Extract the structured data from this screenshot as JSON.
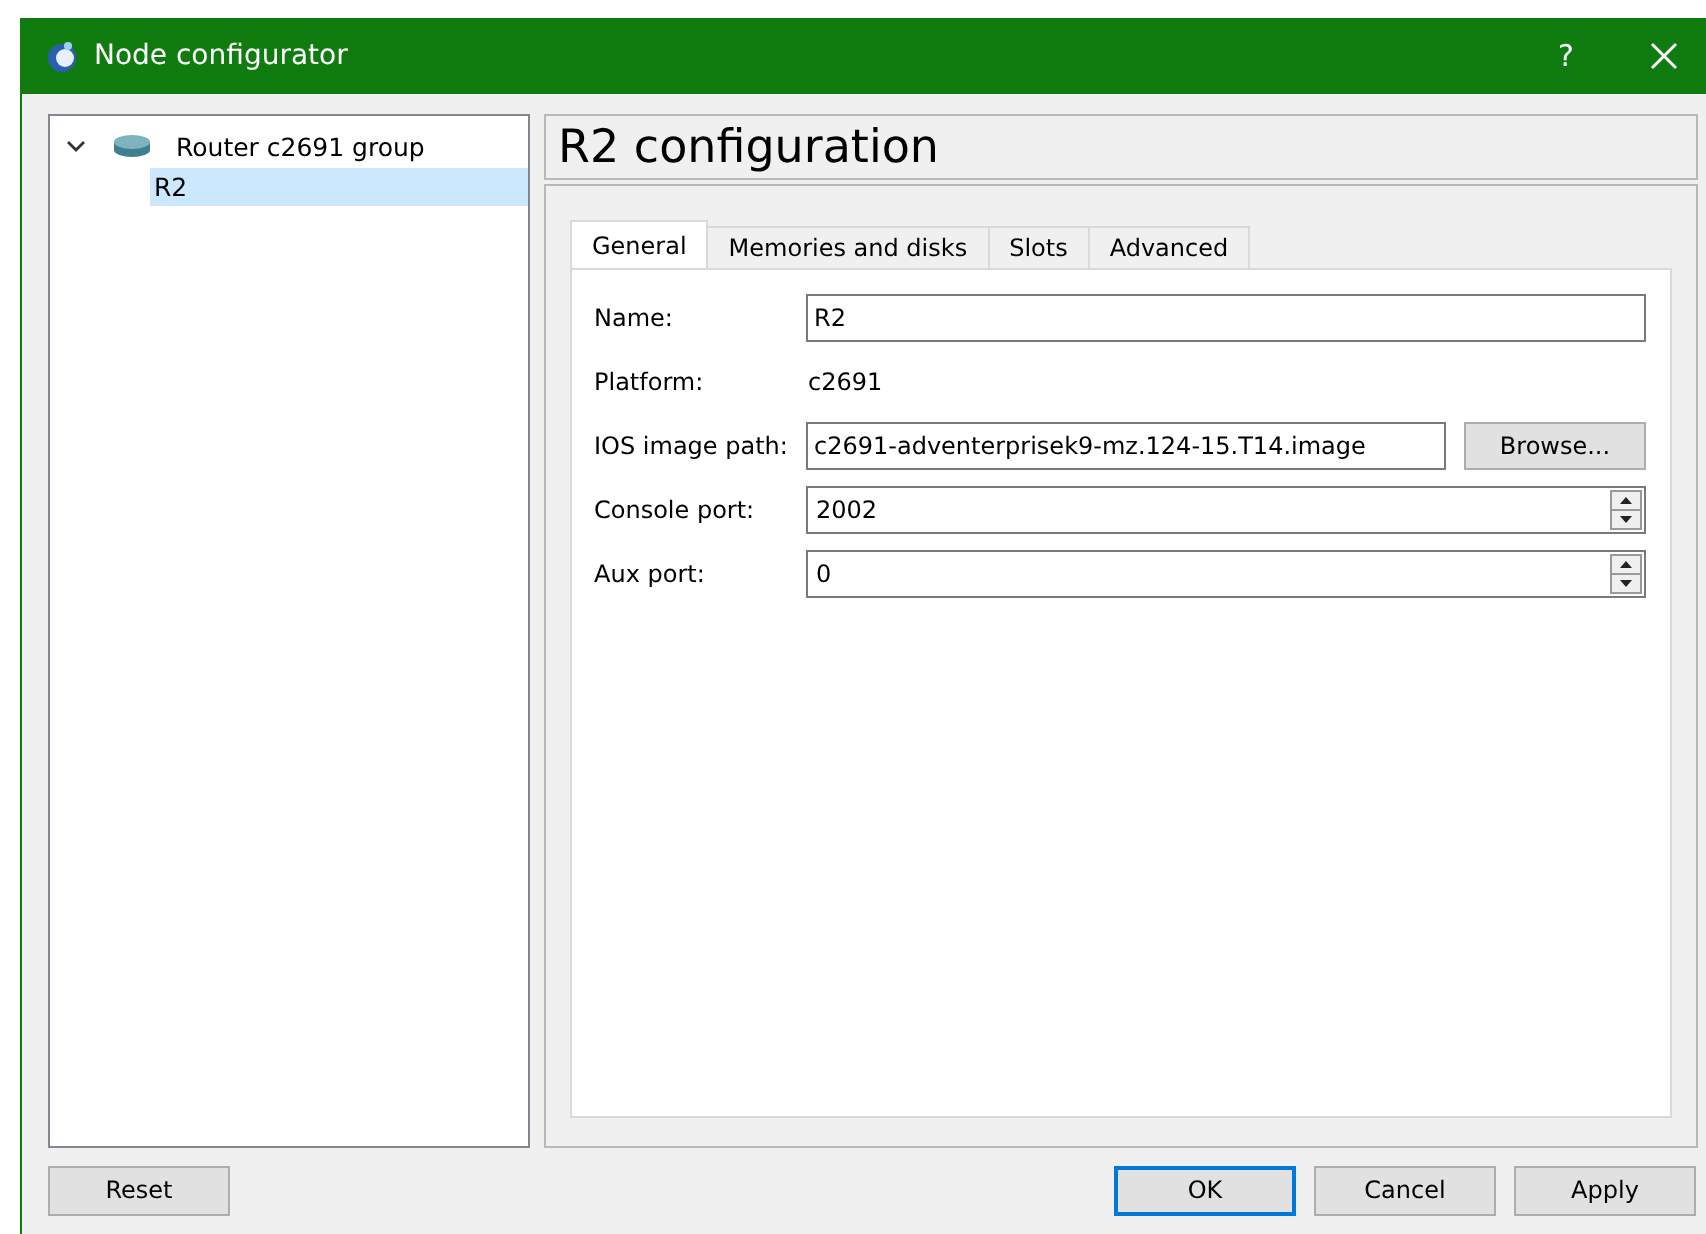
{
  "window": {
    "title": "Node configurator",
    "help": "?"
  },
  "tree": [
    {
      "label": "Router c2691 group",
      "expanded": true,
      "selected": false,
      "children": [
        {
          "label": "R2",
          "selected": true
        }
      ]
    }
  ],
  "header": "R2 configuration",
  "tabs": [
    {
      "label": "General",
      "selected": true
    },
    {
      "label": "Memories and disks",
      "selected": false
    },
    {
      "label": "Slots",
      "selected": false
    },
    {
      "label": "Advanced",
      "selected": false
    }
  ],
  "fields": [
    {
      "kind": "text",
      "label": "Name:",
      "value": "R2"
    },
    {
      "kind": "static",
      "label": "Platform:",
      "value": "c2691"
    },
    {
      "kind": "file",
      "label": "IOS image path:",
      "value": "c2691-adventerprisek9-mz.124-15.T14.image",
      "button": "Browse..."
    },
    {
      "kind": "spin",
      "label": "Console port:",
      "value": "2002"
    },
    {
      "kind": "spin",
      "label": "Aux port:",
      "value": "0"
    }
  ],
  "reset": "Reset",
  "buttons": [
    {
      "label": "OK",
      "default": true
    },
    {
      "label": "Cancel",
      "default": false
    },
    {
      "label": "Apply",
      "default": false
    }
  ]
}
